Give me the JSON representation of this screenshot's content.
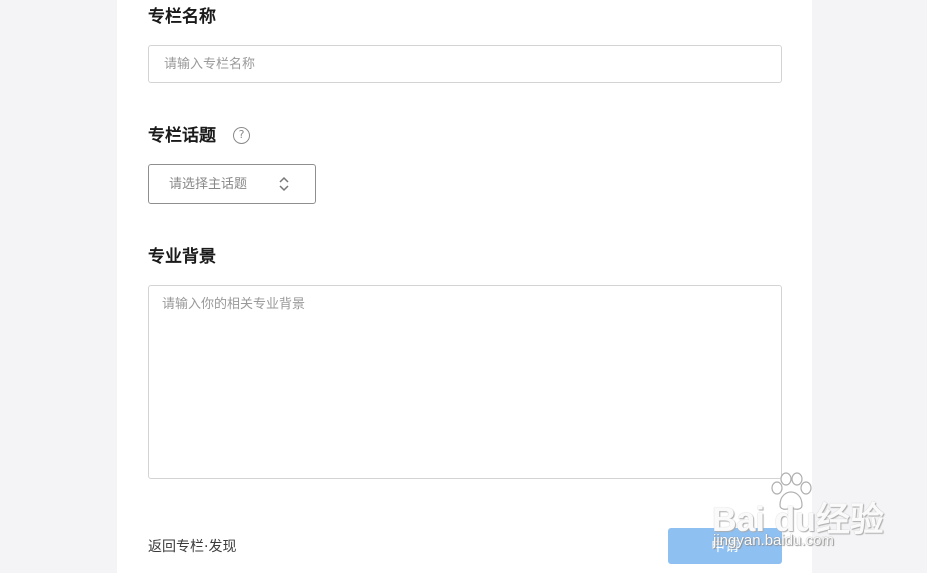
{
  "form": {
    "column_name_label": "专栏名称",
    "column_name_placeholder": "请输入专栏名称",
    "topic_label": "专栏话题",
    "topic_help_glyph": "?",
    "topic_select_value": "请选择主话题",
    "background_label": "专业背景",
    "background_placeholder": "请输入你的相关专业背景"
  },
  "footer": {
    "back_link": "返回专栏·发现",
    "submit_label": "申请"
  },
  "watermark": {
    "brand": "Bai  du经验",
    "url": "jingyan.baidu.com"
  },
  "colors": {
    "submit_bg": "#8fc0f2",
    "page_bg": "#f4f4f6"
  },
  "icons": {
    "help": "question-circle-icon",
    "select": "chevron-up-down-icon",
    "watermark": "baidu-paw-icon"
  }
}
